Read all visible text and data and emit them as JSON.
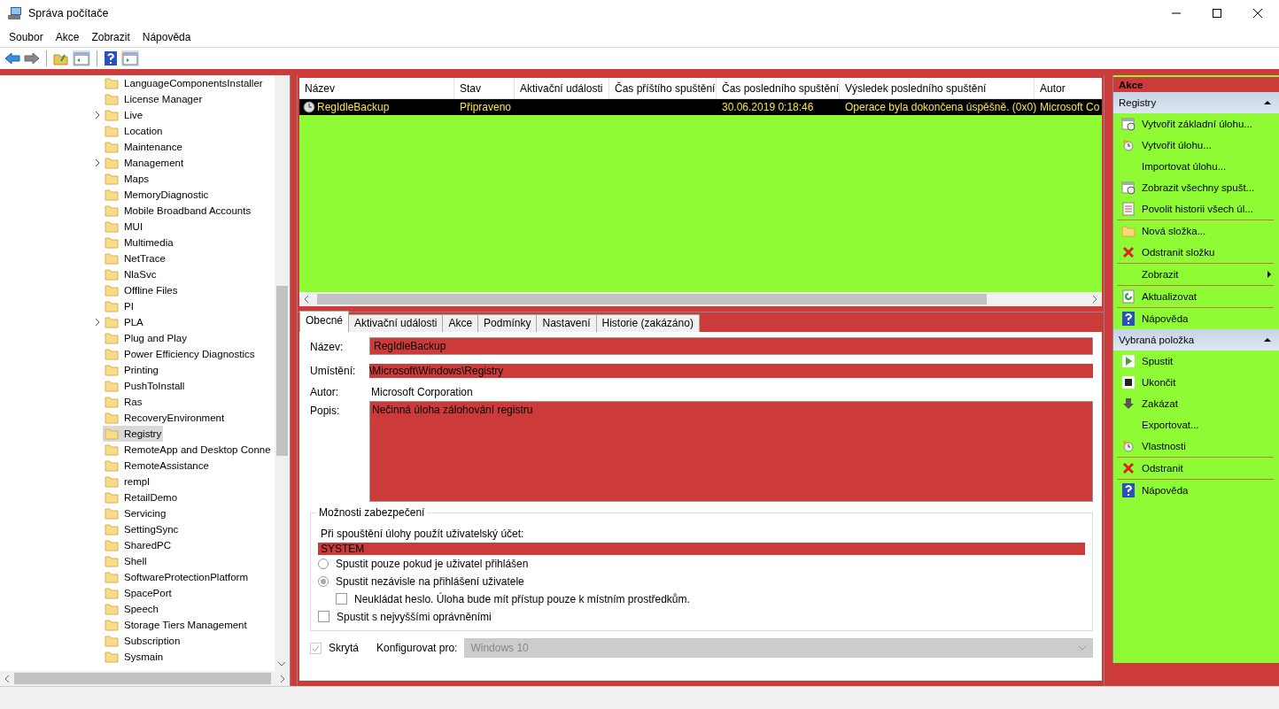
{
  "window": {
    "title": "Správa počítače"
  },
  "menu": [
    "Soubor",
    "Akce",
    "Zobrazit",
    "Nápověda"
  ],
  "tree": {
    "items": [
      {
        "label": "LanguageComponentsInstaller",
        "has_children": false,
        "selected": false
      },
      {
        "label": "License Manager",
        "has_children": false,
        "selected": false
      },
      {
        "label": "Live",
        "has_children": true,
        "selected": false
      },
      {
        "label": "Location",
        "has_children": false,
        "selected": false
      },
      {
        "label": "Maintenance",
        "has_children": false,
        "selected": false
      },
      {
        "label": "Management",
        "has_children": true,
        "selected": false
      },
      {
        "label": "Maps",
        "has_children": false,
        "selected": false
      },
      {
        "label": "MemoryDiagnostic",
        "has_children": false,
        "selected": false
      },
      {
        "label": "Mobile Broadband Accounts",
        "has_children": false,
        "selected": false
      },
      {
        "label": "MUI",
        "has_children": false,
        "selected": false
      },
      {
        "label": "Multimedia",
        "has_children": false,
        "selected": false
      },
      {
        "label": "NetTrace",
        "has_children": false,
        "selected": false
      },
      {
        "label": "NlaSvc",
        "has_children": false,
        "selected": false
      },
      {
        "label": "Offline Files",
        "has_children": false,
        "selected": false
      },
      {
        "label": "PI",
        "has_children": false,
        "selected": false
      },
      {
        "label": "PLA",
        "has_children": true,
        "selected": false
      },
      {
        "label": "Plug and Play",
        "has_children": false,
        "selected": false
      },
      {
        "label": "Power Efficiency Diagnostics",
        "has_children": false,
        "selected": false
      },
      {
        "label": "Printing",
        "has_children": false,
        "selected": false
      },
      {
        "label": "PushToInstall",
        "has_children": false,
        "selected": false
      },
      {
        "label": "Ras",
        "has_children": false,
        "selected": false
      },
      {
        "label": "RecoveryEnvironment",
        "has_children": false,
        "selected": false
      },
      {
        "label": "Registry",
        "has_children": false,
        "selected": true
      },
      {
        "label": "RemoteApp and Desktop Conne",
        "has_children": false,
        "selected": false
      },
      {
        "label": "RemoteAssistance",
        "has_children": false,
        "selected": false
      },
      {
        "label": "rempl",
        "has_children": false,
        "selected": false
      },
      {
        "label": "RetailDemo",
        "has_children": false,
        "selected": false
      },
      {
        "label": "Servicing",
        "has_children": false,
        "selected": false
      },
      {
        "label": "SettingSync",
        "has_children": false,
        "selected": false
      },
      {
        "label": "SharedPC",
        "has_children": false,
        "selected": false
      },
      {
        "label": "Shell",
        "has_children": false,
        "selected": false
      },
      {
        "label": "SoftwareProtectionPlatform",
        "has_children": false,
        "selected": false
      },
      {
        "label": "SpacePort",
        "has_children": false,
        "selected": false
      },
      {
        "label": "Speech",
        "has_children": false,
        "selected": false
      },
      {
        "label": "Storage Tiers Management",
        "has_children": false,
        "selected": false
      },
      {
        "label": "Subscription",
        "has_children": false,
        "selected": false
      },
      {
        "label": "Sysmain",
        "has_children": false,
        "selected": false
      }
    ]
  },
  "task_list": {
    "columns": [
      "Název",
      "Stav",
      "Aktivační události",
      "Čas příštího spuštění",
      "Čas posledního spuštění",
      "Výsledek posledního spuštění",
      "Autor"
    ],
    "rows": [
      {
        "cells": [
          "RegIdleBackup",
          "Připraveno",
          "",
          "",
          "30.06.2019 0:18:46",
          "Operace byla dokončena úspěšně. (0x0)",
          "Microsoft Co"
        ],
        "selected": true
      }
    ]
  },
  "details": {
    "tabs": [
      {
        "label": "Obecné",
        "selected": true
      },
      {
        "label": "Aktivační události",
        "selected": false
      },
      {
        "label": "Akce",
        "selected": false
      },
      {
        "label": "Podmínky",
        "selected": false
      },
      {
        "label": "Nastavení",
        "selected": false
      },
      {
        "label": "Historie (zakázáno)",
        "selected": false
      }
    ],
    "fields": [
      {
        "label": "Název:",
        "value": "RegIdleBackup",
        "kind": "input"
      },
      {
        "label": "Umístění:",
        "value": "\\Microsoft\\Windows\\Registry",
        "kind": "readonly"
      },
      {
        "label": "Autor:",
        "value": "Microsoft Corporation",
        "kind": "text"
      },
      {
        "label": "Popis:",
        "value": "Nečinná úloha zálohování registru",
        "kind": "textarea"
      }
    ],
    "security": {
      "title": "Možnosti zabezpečení",
      "account_label": "Při spouštění úlohy použít uživatelský účet:",
      "account": "SYSTEM",
      "options": [
        {
          "kind": "radio",
          "label": "Spustit pouze pokud je uživatel přihlášen",
          "selected": false
        },
        {
          "kind": "radio",
          "label": "Spustit nezávisle na přihlášení uživatele",
          "selected": true,
          "children": [
            {
              "kind": "checkbox",
              "label": "Neukládat heslo. Úloha bude mít přístup pouze k místním prostředkům.",
              "checked": false
            }
          ]
        },
        {
          "kind": "checkbox",
          "label": "Spustit s nejvyššími oprávněními",
          "checked": false
        }
      ]
    },
    "hidden": {
      "label": "Skrytá",
      "checked": true,
      "disabled": true
    },
    "configure_for": {
      "label": "Konfigurovat pro:",
      "value": "Windows 10",
      "disabled": true
    }
  },
  "action_panel": {
    "title": "Akce",
    "groups": [
      {
        "title": "Registry",
        "expanded": true,
        "sections": [
          {
            "items": [
              {
                "label": "Vytvořit základní úlohu...",
                "submenu": false
              },
              {
                "label": "Vytvořit úlohu...",
                "submenu": false
              },
              {
                "label": "Importovat úlohu...",
                "submenu": false
              },
              {
                "label": "Zobrazit všechny spušt...",
                "submenu": false
              },
              {
                "label": "Povolit historii všech úl...",
                "submenu": false
              }
            ]
          },
          {
            "items": [
              {
                "label": "Nová složka...",
                "submenu": false
              },
              {
                "label": "Odstranit složku",
                "submenu": false
              }
            ]
          },
          {
            "items": [
              {
                "label": "Zobrazit",
                "submenu": true
              }
            ]
          },
          {
            "items": [
              {
                "label": "Aktualizovat",
                "submenu": false
              }
            ]
          },
          {
            "items": [
              {
                "label": "Nápověda",
                "submenu": false
              }
            ]
          }
        ]
      },
      {
        "title": "Vybraná položka",
        "expanded": true,
        "sections": [
          {
            "items": [
              {
                "label": "Spustit",
                "submenu": false
              },
              {
                "label": "Ukončit",
                "submenu": false
              },
              {
                "label": "Zakázat",
                "submenu": false
              },
              {
                "label": "Exportovat...",
                "submenu": false
              },
              {
                "label": "Vlastnosti",
                "submenu": false
              }
            ]
          },
          {
            "items": [
              {
                "label": "Odstranit",
                "submenu": false
              }
            ]
          },
          {
            "items": [
              {
                "label": "Nápověda",
                "submenu": false
              }
            ]
          }
        ]
      }
    ]
  }
}
